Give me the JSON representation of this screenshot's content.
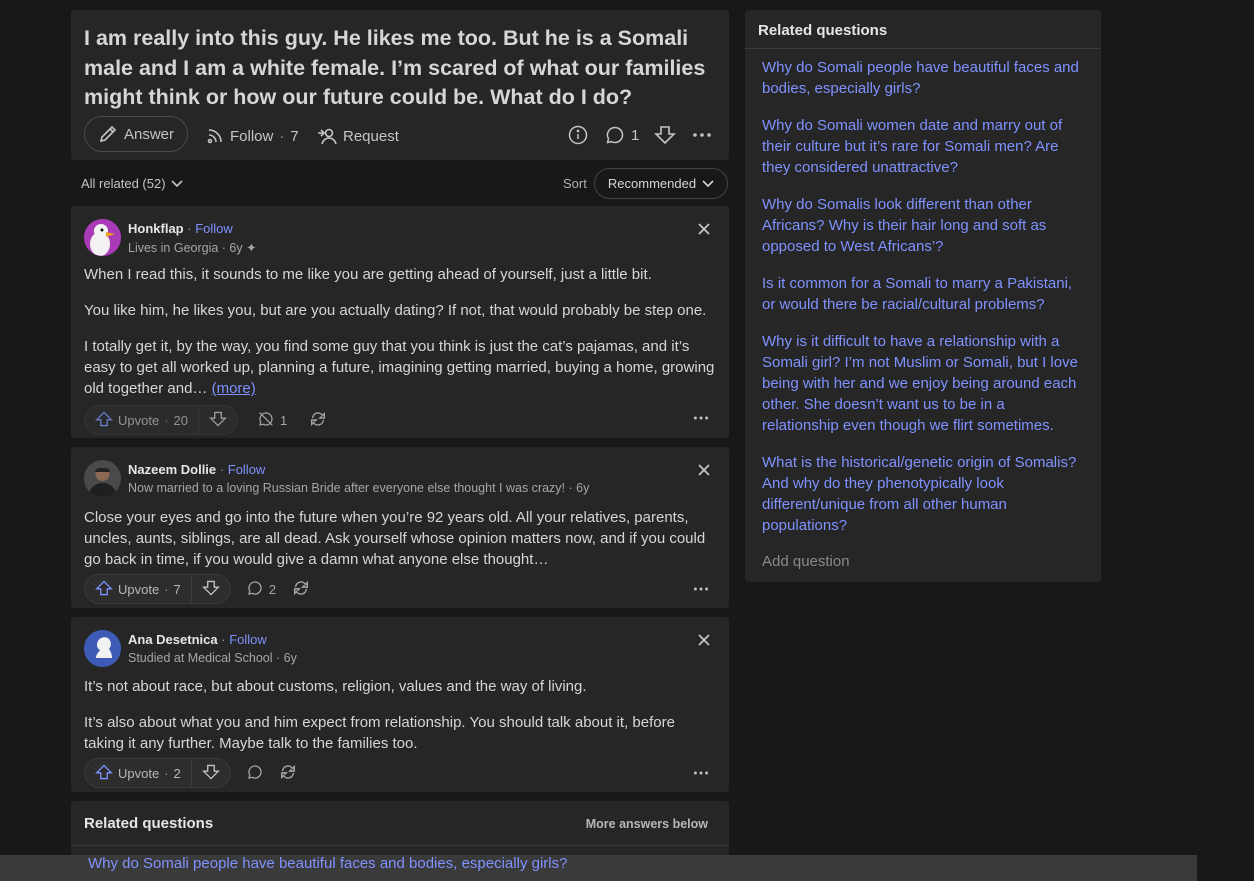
{
  "question": {
    "title": "I am really into this guy. He likes me too. But he is a Somali male and I am a white female. I’m scared of what our families might think or how our future could be. What do I do?",
    "answer_label": "Answer",
    "follow_label": "Follow",
    "follow_count": "7",
    "request_label": "Request",
    "comment_count": "1"
  },
  "sort_bar": {
    "all_related": "All related (52)",
    "sort_label": "Sort",
    "sort_value": "Recommended"
  },
  "answers": [
    {
      "author": "Honkflap",
      "follow": "Follow",
      "credential": "Lives in Georgia · 6y",
      "paragraphs": [
        "When I read this, it sounds to me like you are getting ahead of yourself, just a little bit.",
        "You like him, he likes you, but are you actually dating? If not, that would probably be step one.",
        "I totally get it, by the way, you find some guy that you think is just the cat’s pajamas, and it’s easy to get all worked up, planning a future, imagining getting married, buying a home, growing old together and…"
      ],
      "more": "(more)",
      "upvote_label": "Upvote",
      "upvotes": "20",
      "comments": "1",
      "avatar_color": "#a93bb8"
    },
    {
      "author": "Nazeem Dollie",
      "follow": "Follow",
      "credential": "Now married to a loving Russian Bride after everyone else thought I was crazy! · 6y",
      "paragraphs": [
        "Close your eyes and go into the future when you’re 92 years old. All your relatives, parents, uncles, aunts, siblings, are all dead. Ask yourself whose opinion matters now, and if you could go back in time, if you would give a damn what anyone else thought…"
      ],
      "upvote_label": "Upvote",
      "upvotes": "7",
      "comments": "2"
    },
    {
      "author": "Ana Desetnica",
      "follow": "Follow",
      "credential": "Studied at Medical School · 6y",
      "paragraphs": [
        "It’s not about race, but about customs, religion, values and the way of living.",
        "It’s also about what you and him expect from relationship. You should talk about it, before taking it any further. Maybe talk to the families too."
      ],
      "upvote_label": "Upvote",
      "upvotes": "2",
      "comments": ""
    }
  ],
  "bottom_related": {
    "title": "Related questions",
    "more_below": "More answers below",
    "first_link": "Why do Somali people have beautiful faces and bodies, especially girls?"
  },
  "sidebar": {
    "title": "Related questions",
    "items": [
      "Why do Somali people have beautiful faces and bodies, especially girls?",
      "Why do Somali women date and marry out of their culture but it’s rare for Somali men? Are they considered unattractive?",
      "Why do Somalis look different than other Africans? Why is their hair long and soft as opposed to West Africans’?",
      "Is it common for a Somali to marry a Pakistani, or would there be racial/cultural problems?",
      "Why is it difficult to have a relationship with a Somali girl? I’m not Muslim or Somali, but I love being with her and we enjoy being around each other. She doesn’t want us to be in a relationship even though we flirt sometimes.",
      "What is the historical/genetic origin of Somalis? And why do they phenotypically look different/unique from all other human populations?"
    ],
    "add_question": "Add question"
  },
  "colors": {
    "background": "#181818",
    "card": "#262626",
    "link": "#7f92ff",
    "text": "#d5d6d6"
  }
}
